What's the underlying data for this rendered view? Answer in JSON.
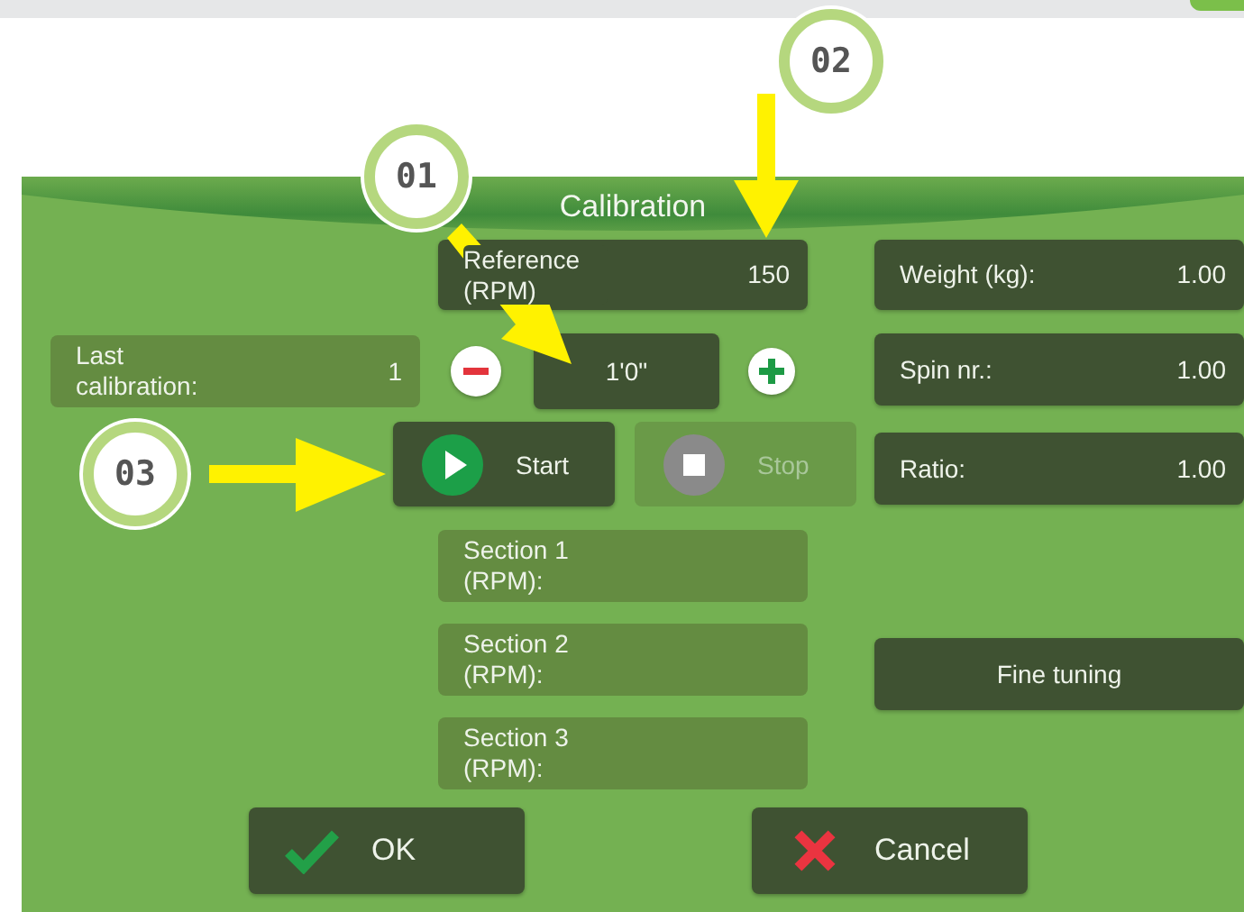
{
  "title": "Calibration",
  "reference": {
    "label": "Reference (RPM)",
    "value": "150",
    "kind": "input"
  },
  "last_calibration": {
    "label": "Last calibration:",
    "value": "1",
    "kind": "display"
  },
  "stepper": {
    "value": "1'0\""
  },
  "start": {
    "label": "Start",
    "disabled": false
  },
  "stop": {
    "label": "Stop",
    "disabled": true
  },
  "sections": [
    {
      "label": "Section 1 (RPM):",
      "kind": "display"
    },
    {
      "label": "Section 2 (RPM):",
      "kind": "display"
    },
    {
      "label": "Section 3 (RPM):",
      "kind": "display"
    }
  ],
  "right_fields": [
    {
      "label": "Weight (kg):",
      "value": "1.00",
      "kind": "input"
    },
    {
      "label": "Spin nr.:",
      "value": "1.00",
      "kind": "input"
    },
    {
      "label": "Ratio:",
      "value": "1.00",
      "kind": "input"
    }
  ],
  "fine_tuning": "Fine tuning",
  "buttons": [
    {
      "label": "OK",
      "kind": "ok"
    },
    {
      "label": "Cancel",
      "kind": "cancel"
    }
  ],
  "callouts": [
    "01",
    "02",
    "03"
  ]
}
